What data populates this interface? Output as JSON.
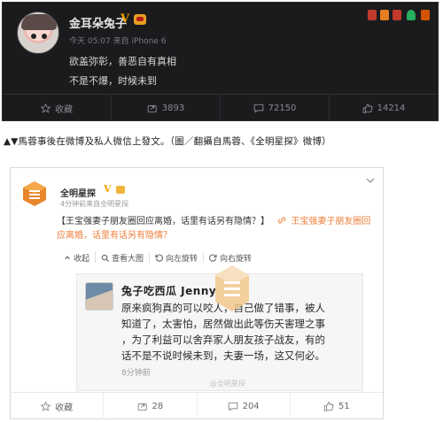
{
  "top_post": {
    "username": "金耳朵兔子",
    "verified_mark": "V",
    "meta": "今天 05:07 来自 iPhone 6",
    "lines": [
      "欲盖弥彰，善恶自有真相",
      "不是不爆，时候未到"
    ],
    "actions": {
      "favorite": "收藏",
      "repost": "3893",
      "comment": "72150",
      "like": "14214"
    }
  },
  "caption": "▲▼馬蓉事後在微博及私人微信上發文。（圖／翻攝自馬蓉、《全明星探》微博）",
  "second_post": {
    "username": "全明星探",
    "verified_mark": "V",
    "meta": "4分钟前来自全明星探",
    "body_lines": [
      {
        "text": "【王宝强妻子朋友圈回应离婚，话里有话另有隐情？】",
        "link": "王宝强妻子朋友圈回"
      },
      {
        "text": "应离婚，话里有话另有隐情？"
      }
    ],
    "tools": [
      "收起",
      "查看大图",
      "向左旋转",
      "向右旋转"
    ],
    "embedded": {
      "name": "兔子吃西瓜 Jenny",
      "lines": [
        "原来疯狗真的可以咬人，自己做了错事，被人",
        "知道了，太害怕，居然做出此等伤天害理之事",
        "，为了利益可以舍弃家人朋友孩子战友，有的",
        "话不是不说时候未到，夫妻一场，这又何必。"
      ],
      "time": "8分钟前",
      "watermark": "@全明星探"
    },
    "actions": {
      "favorite": "收藏",
      "repost": "28",
      "comment": "204",
      "like": "51"
    }
  },
  "colors": {
    "dark_bg": "#1b1b1e",
    "verified": "#f5a300",
    "link": "#ef7f3b"
  }
}
